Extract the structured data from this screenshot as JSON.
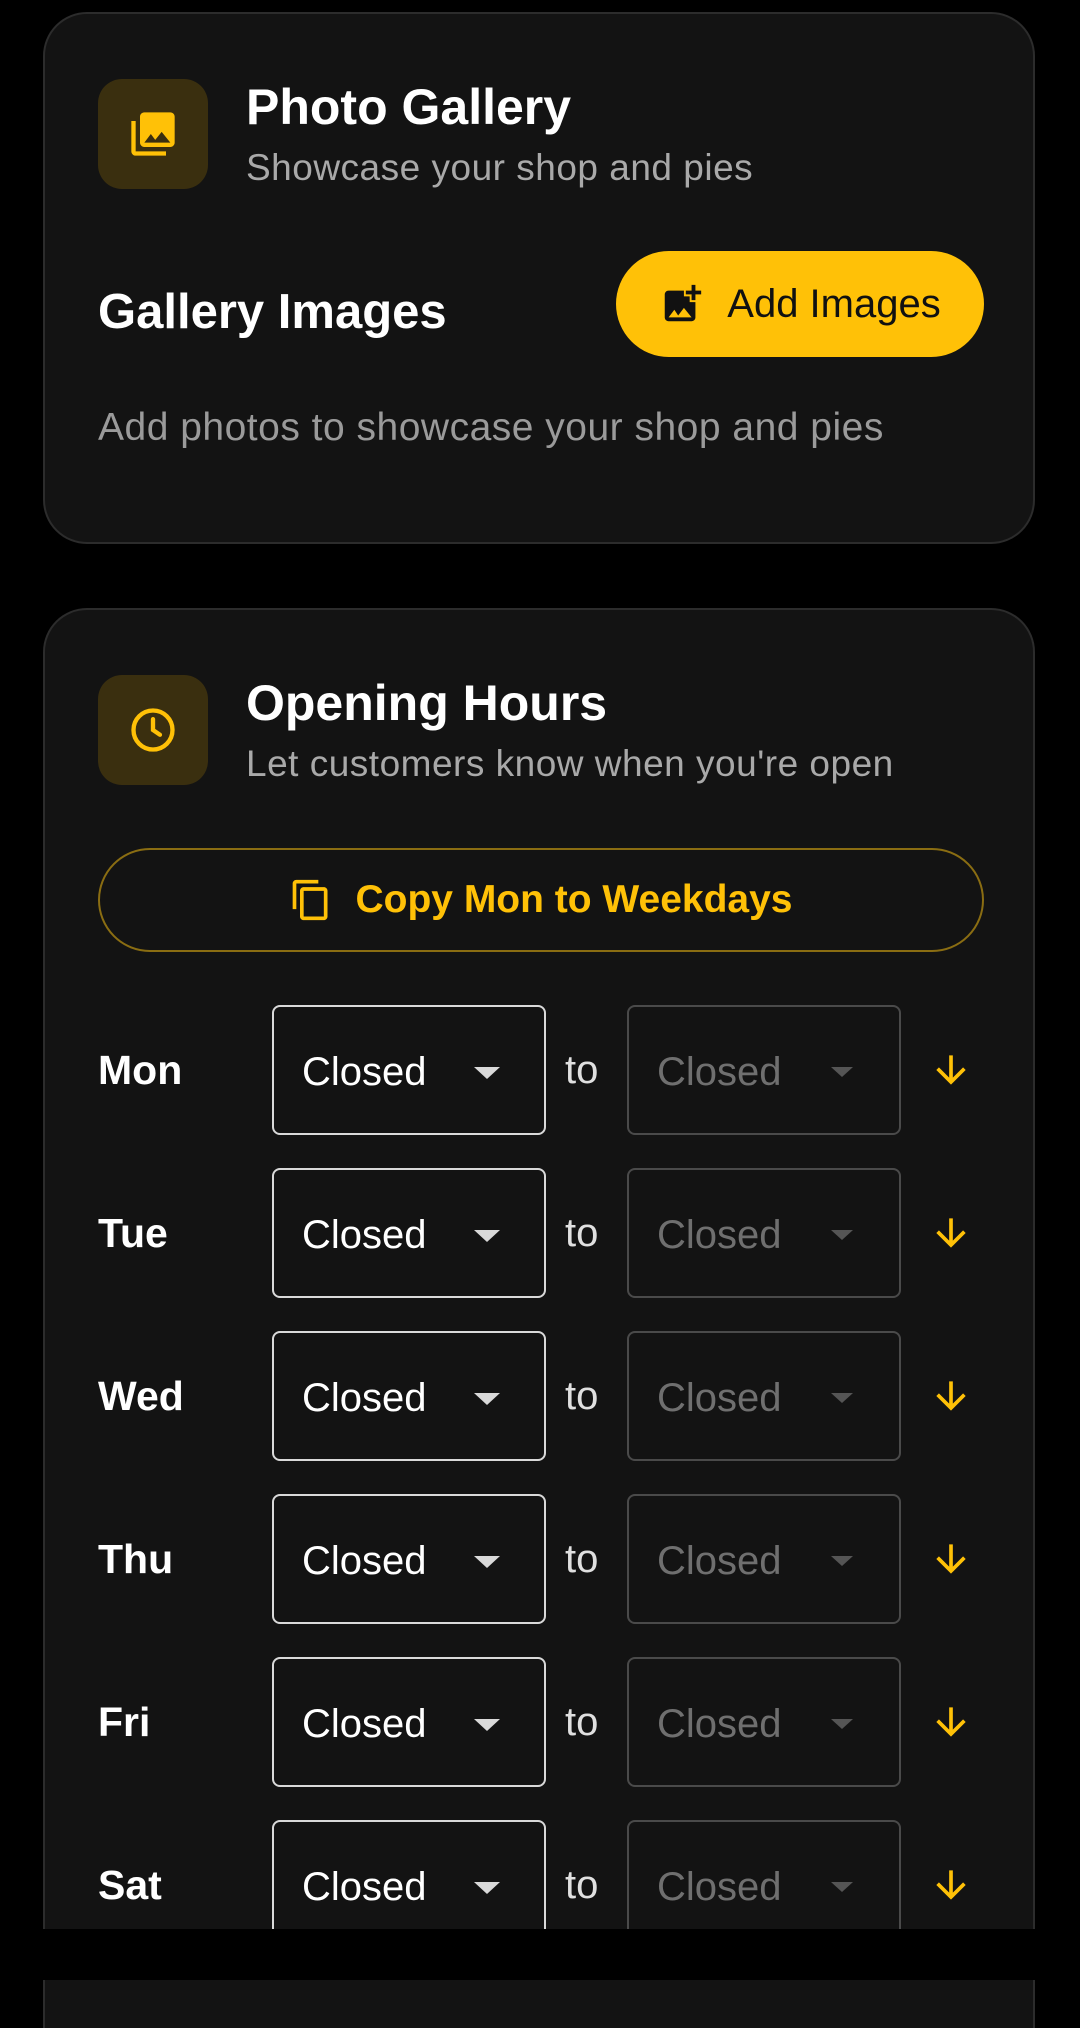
{
  "gallery": {
    "title": "Photo Gallery",
    "subtitle": "Showcase your shop and pies",
    "icon": "photo-library-icon",
    "section_title": "Gallery Images",
    "add_button_label": "Add Images",
    "add_button_icon": "add-photo-icon",
    "empty_text": "Add photos to showcase your shop and pies"
  },
  "hours": {
    "title": "Opening Hours",
    "subtitle": "Let customers know when you're open",
    "icon": "clock-icon",
    "copy_button_label": "Copy Mon to Weekdays",
    "copy_button_icon": "copy-icon",
    "to_label": "to",
    "days": [
      {
        "day": "Mon",
        "open": "Closed",
        "close": "Closed"
      },
      {
        "day": "Tue",
        "open": "Closed",
        "close": "Closed"
      },
      {
        "day": "Wed",
        "open": "Closed",
        "close": "Closed"
      },
      {
        "day": "Thu",
        "open": "Closed",
        "close": "Closed"
      },
      {
        "day": "Fri",
        "open": "Closed",
        "close": "Closed"
      },
      {
        "day": "Sat",
        "open": "Closed",
        "close": "Closed"
      }
    ]
  },
  "colors": {
    "accent": "#ffc107",
    "background": "#000000",
    "card": "#131313",
    "icon_tile": "#3a2f0f"
  }
}
